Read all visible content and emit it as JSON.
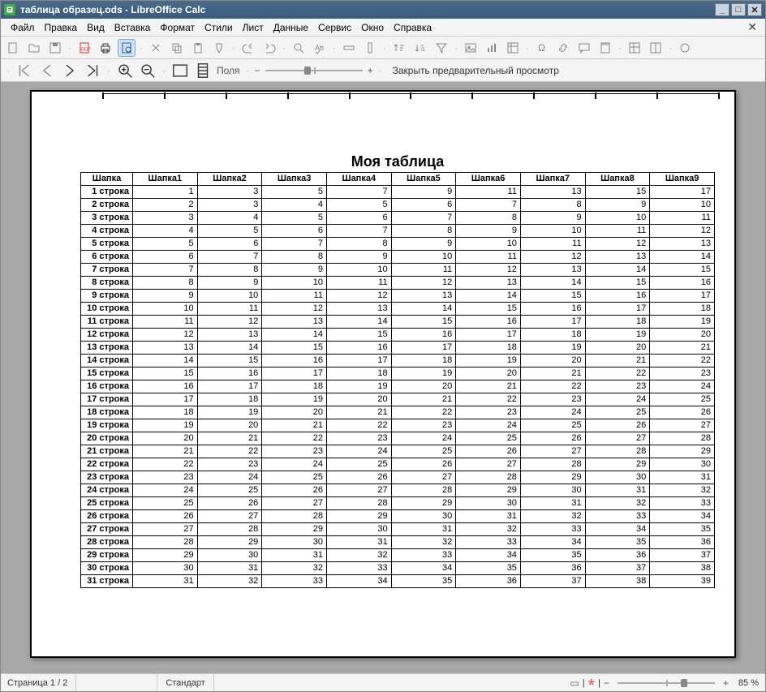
{
  "app": {
    "title": "таблица образец.ods - LibreOffice Calc"
  },
  "menus": [
    "Файл",
    "Правка",
    "Вид",
    "Вставка",
    "Формат",
    "Стили",
    "Лист",
    "Данные",
    "Сервис",
    "Окно",
    "Справка"
  ],
  "toolbar2": {
    "fields_label": "Поля",
    "close_preview": "Закрыть предварительный просмотр"
  },
  "sheet": {
    "title": "Моя таблица",
    "headers": [
      "Шапка",
      "Шапка1",
      "Шапка2",
      "Шапка3",
      "Шапка4",
      "Шапка5",
      "Шапка6",
      "Шапка7",
      "Шапка8",
      "Шапка9"
    ],
    "rows": [
      {
        "label": "1 строка",
        "vals": [
          1,
          3,
          5,
          7,
          9,
          11,
          13,
          15,
          17
        ]
      },
      {
        "label": "2 строка",
        "vals": [
          2,
          3,
          4,
          5,
          6,
          7,
          8,
          9,
          10
        ]
      },
      {
        "label": "3 строка",
        "vals": [
          3,
          4,
          5,
          6,
          7,
          8,
          9,
          10,
          11
        ]
      },
      {
        "label": "4 строка",
        "vals": [
          4,
          5,
          6,
          7,
          8,
          9,
          10,
          11,
          12
        ]
      },
      {
        "label": "5 строка",
        "vals": [
          5,
          6,
          7,
          8,
          9,
          10,
          11,
          12,
          13
        ]
      },
      {
        "label": "6 строка",
        "vals": [
          6,
          7,
          8,
          9,
          10,
          11,
          12,
          13,
          14
        ]
      },
      {
        "label": "7 строка",
        "vals": [
          7,
          8,
          9,
          10,
          11,
          12,
          13,
          14,
          15
        ]
      },
      {
        "label": "8 строка",
        "vals": [
          8,
          9,
          10,
          11,
          12,
          13,
          14,
          15,
          16
        ]
      },
      {
        "label": "9 строка",
        "vals": [
          9,
          10,
          11,
          12,
          13,
          14,
          15,
          16,
          17
        ]
      },
      {
        "label": "10 строка",
        "vals": [
          10,
          11,
          12,
          13,
          14,
          15,
          16,
          17,
          18
        ]
      },
      {
        "label": "11 строка",
        "vals": [
          11,
          12,
          13,
          14,
          15,
          16,
          17,
          18,
          19
        ]
      },
      {
        "label": "12 строка",
        "vals": [
          12,
          13,
          14,
          15,
          16,
          17,
          18,
          19,
          20
        ]
      },
      {
        "label": "13 строка",
        "vals": [
          13,
          14,
          15,
          16,
          17,
          18,
          19,
          20,
          21
        ]
      },
      {
        "label": "14 строка",
        "vals": [
          14,
          15,
          16,
          17,
          18,
          19,
          20,
          21,
          22
        ]
      },
      {
        "label": "15 строка",
        "vals": [
          15,
          16,
          17,
          18,
          19,
          20,
          21,
          22,
          23
        ]
      },
      {
        "label": "16 строка",
        "vals": [
          16,
          17,
          18,
          19,
          20,
          21,
          22,
          23,
          24
        ]
      },
      {
        "label": "17 строка",
        "vals": [
          17,
          18,
          19,
          20,
          21,
          22,
          23,
          24,
          25
        ]
      },
      {
        "label": "18 строка",
        "vals": [
          18,
          19,
          20,
          21,
          22,
          23,
          24,
          25,
          26
        ]
      },
      {
        "label": "19 строка",
        "vals": [
          19,
          20,
          21,
          22,
          23,
          24,
          25,
          26,
          27
        ]
      },
      {
        "label": "20 строка",
        "vals": [
          20,
          21,
          22,
          23,
          24,
          25,
          26,
          27,
          28
        ]
      },
      {
        "label": "21 строка",
        "vals": [
          21,
          22,
          23,
          24,
          25,
          26,
          27,
          28,
          29
        ]
      },
      {
        "label": "22 строка",
        "vals": [
          22,
          23,
          24,
          25,
          26,
          27,
          28,
          29,
          30
        ]
      },
      {
        "label": "23 строка",
        "vals": [
          23,
          24,
          25,
          26,
          27,
          28,
          29,
          30,
          31
        ]
      },
      {
        "label": "24 строка",
        "vals": [
          24,
          25,
          26,
          27,
          28,
          29,
          30,
          31,
          32
        ]
      },
      {
        "label": "25 строка",
        "vals": [
          25,
          26,
          27,
          28,
          29,
          30,
          31,
          32,
          33
        ]
      },
      {
        "label": "26 строка",
        "vals": [
          26,
          27,
          28,
          29,
          30,
          31,
          32,
          33,
          34
        ]
      },
      {
        "label": "27 строка",
        "vals": [
          27,
          28,
          29,
          30,
          31,
          32,
          33,
          34,
          35
        ]
      },
      {
        "label": "28 строка",
        "vals": [
          28,
          29,
          30,
          31,
          32,
          33,
          34,
          35,
          36
        ]
      },
      {
        "label": "29 строка",
        "vals": [
          29,
          30,
          31,
          32,
          33,
          34,
          35,
          36,
          37
        ]
      },
      {
        "label": "30 строка",
        "vals": [
          30,
          31,
          32,
          33,
          34,
          35,
          36,
          37,
          38
        ]
      },
      {
        "label": "31 строка",
        "vals": [
          31,
          32,
          33,
          34,
          35,
          36,
          37,
          38,
          39
        ]
      }
    ]
  },
  "status": {
    "page": "Страница 1 / 2",
    "style": "Стандарт",
    "zoom": "85 %"
  }
}
